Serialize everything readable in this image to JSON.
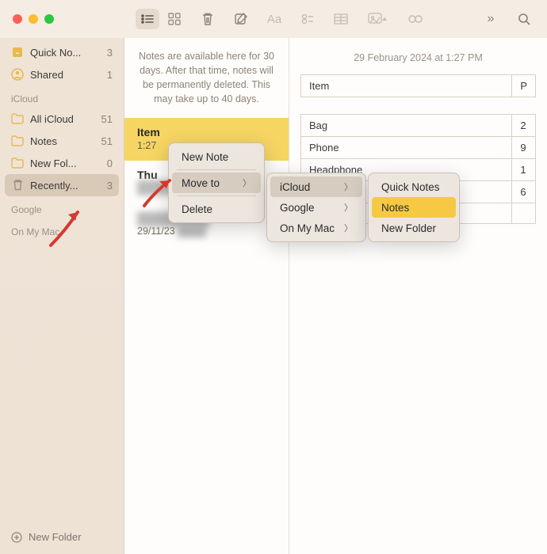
{
  "sidebar": {
    "favorites": [
      {
        "label": "Quick No...",
        "count": "3",
        "icon": "quicknotes"
      },
      {
        "label": "Shared",
        "count": "1",
        "icon": "shared"
      }
    ],
    "sections": [
      {
        "header": "iCloud",
        "items": [
          {
            "label": "All iCloud",
            "count": "51",
            "icon": "folder"
          },
          {
            "label": "Notes",
            "count": "51",
            "icon": "folder"
          },
          {
            "label": "New Fol...",
            "count": "0",
            "icon": "folder"
          },
          {
            "label": "Recently...",
            "count": "3",
            "icon": "trash",
            "selected": true
          }
        ]
      },
      {
        "header": "Google",
        "items": []
      },
      {
        "header": "On My Mac",
        "items": []
      }
    ],
    "footer": {
      "label": "New Folder"
    }
  },
  "list": {
    "info": "Notes are available here for 30 days. After that time, notes will be permanently deleted. This may take up to 40 days.",
    "rows": [
      {
        "title": "Item",
        "sub": "1:27",
        "selected": true
      },
      {
        "title": "Thu",
        "sub": ""
      },
      {
        "title": "",
        "sub": "29/11/23"
      }
    ]
  },
  "content": {
    "date": "29 February 2024 at 1:27 PM",
    "table": {
      "header": [
        "Item",
        "P"
      ],
      "rows": [
        [
          "Bag",
          "2"
        ],
        [
          "Phone",
          "9"
        ],
        [
          "Headphone",
          "1"
        ],
        [
          "",
          "6"
        ],
        [
          "",
          ""
        ]
      ]
    }
  },
  "context_menu": {
    "level1": [
      {
        "label": "New Note"
      },
      {
        "sep": true
      },
      {
        "label": "Move to",
        "submenu": true,
        "highlight": true
      },
      {
        "sep": true
      },
      {
        "label": "Delete"
      }
    ],
    "level2": [
      {
        "label": "iCloud",
        "submenu": true,
        "highlight": true
      },
      {
        "label": "Google",
        "submenu": true
      },
      {
        "label": "On My Mac",
        "submenu": true
      }
    ],
    "level3": [
      {
        "label": "Quick Notes"
      },
      {
        "label": "Notes",
        "yellow": true
      },
      {
        "label": "New Folder"
      }
    ]
  }
}
